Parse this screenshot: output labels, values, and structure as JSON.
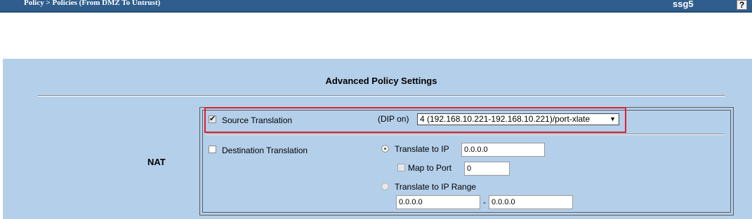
{
  "header": {
    "breadcrumb": "Policy > Policies (From DMZ To Untrust)",
    "device_name": "ssg5",
    "help_label": "?"
  },
  "panel": {
    "title": "Advanced Policy Settings",
    "nat_label": "NAT"
  },
  "source_translation": {
    "label": "Source Translation",
    "checked": true,
    "dip_label": "(DIP on)",
    "dip_selected": "4 (192.168.10.221-192.168.10.221)/port-xlate"
  },
  "destination_translation": {
    "label": "Destination Translation",
    "checked": false,
    "translate_to_ip": {
      "label": "Translate to IP",
      "value": "0.0.0.0",
      "selected": true
    },
    "map_to_port": {
      "label": "Map to Port",
      "value": "0",
      "checked": false
    },
    "translate_to_ip_range": {
      "label": "Translate to IP Range",
      "from": "0.0.0.0",
      "separator": "-",
      "to": "0.0.0.0",
      "selected": false
    }
  },
  "colors": {
    "header_bg": "#2f5e8e",
    "panel_bg": "#b4cfea",
    "highlight": "#e0202c"
  }
}
